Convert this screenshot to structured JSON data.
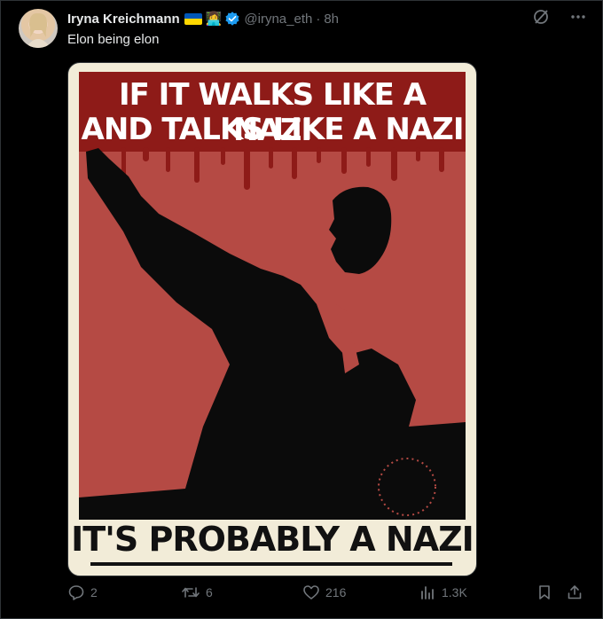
{
  "tweet": {
    "author_name": "Iryna Kreichmann",
    "author_emoji": "👩‍💻",
    "handle": "@iryna_eth",
    "separator": "·",
    "time": "8h",
    "text": "Elon being elon"
  },
  "poster": {
    "line1": "IF IT WALKS LIKE A NAZI",
    "line2": "AND TALKS LIKE A NAZI",
    "bottom": "IT'S PROBABLY A NAZI"
  },
  "actions": {
    "replies": "2",
    "retweets": "6",
    "likes": "216",
    "views": "1.3K"
  },
  "colors": {
    "background": "#000000",
    "text": "#e7e9ea",
    "muted": "#71767b",
    "verified": "#1d9bf0",
    "poster_red": "#b54a44",
    "poster_dark_red": "#8e1b18",
    "poster_cream": "#f2ecd8"
  }
}
